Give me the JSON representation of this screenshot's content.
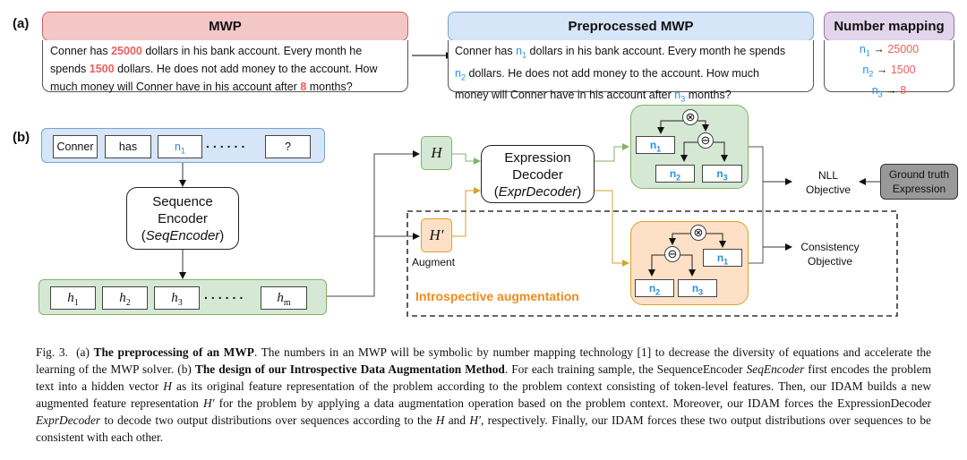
{
  "panel_a": {
    "label": "(a)",
    "mwp": {
      "title": "MWP",
      "text_parts": [
        {
          "t": "Conner has "
        },
        {
          "t": "25000",
          "num": true
        },
        {
          "t": " dollars in his bank account. Every month he spends "
        },
        {
          "t": "1500",
          "num": true
        },
        {
          "t": " dollars. He does not add money to the account. How much money will Conner have in his account after "
        },
        {
          "t": "8",
          "num": true
        },
        {
          "t": " months?"
        }
      ]
    },
    "preprocessed": {
      "title": "Preprocessed MWP",
      "line1_a": "Conner has ",
      "line1_sym": "n",
      "line1_sub": "1",
      "line1_b": " dollars in his bank account. Every month he spends",
      "line2_sym": "n",
      "line2_sub": "2",
      "line2_b": " dollars. He does not add money to the account. How much",
      "line3_a": "money will Conner have in his account after ",
      "line3_sym": "n",
      "line3_sub": "3",
      "line3_b": " months?"
    },
    "mapping": {
      "title": "Number mapping",
      "rows": [
        {
          "sym": "n",
          "sub": "1",
          "arrow": "→",
          "value": "25000"
        },
        {
          "sym": "n",
          "sub": "2",
          "arrow": "→",
          "value": "1500"
        },
        {
          "sym": "n",
          "sub": "3",
          "arrow": "→",
          "value": "8"
        }
      ]
    }
  },
  "panel_b": {
    "label": "(b)",
    "input_tokens": [
      "Conner",
      "has",
      "n1",
      "?"
    ],
    "n1_sym": "n",
    "n1_sub": "1",
    "dots": "......",
    "encoder": {
      "line1": "Sequence",
      "line2": "Encoder",
      "line3_open": "(",
      "line3_name": "SeqEncoder",
      "line3_close": ")"
    },
    "hidden_tokens": [
      {
        "h": "h",
        "sub": "1"
      },
      {
        "h": "h",
        "sub": "2"
      },
      {
        "h": "h",
        "sub": "3"
      },
      {
        "h": "h",
        "sub": "m"
      }
    ],
    "H": "H",
    "H_prime": "H′",
    "augment_label": "Augment",
    "decoder": {
      "line1": "Expression",
      "line2": "Decoder",
      "line3_open": "(",
      "line3_name": "ExprDecoder",
      "line3_close": ")"
    },
    "tree_ops": {
      "mul": "⊗",
      "sub": "⊖"
    },
    "leaf": {
      "n": "n",
      "s1": "1",
      "s2": "2",
      "s3": "3"
    },
    "nll": {
      "line1": "NLL",
      "line2": "Objective"
    },
    "ground_truth": {
      "line1": "Ground truth",
      "line2": "Expression"
    },
    "consistency": {
      "line1": "Consistency",
      "line2": "Objective"
    },
    "introspective_label": "Introspective augmentation"
  },
  "caption": {
    "fig": "Fig. 3.",
    "a_prefix": "(a) ",
    "a_bold": "The preprocessing of an MWP",
    "a_text": ". The numbers in an MWP will be symbolic by number mapping technology [1] to decrease the diversity of equations and accelerate the learning of the MWP solver. ",
    "b_prefix": "(b) ",
    "b_bold": "The design of our Introspective Data Augmentation Method",
    "b_text1": ". For each training sample, the SequenceEncoder ",
    "b_seq": "SeqEncoder",
    "b_text2": " first encodes the problem text into a hidden vector ",
    "b_H": "H",
    "b_text3": " as its original feature representation of the problem according to the problem context consisting of token-level features. Then, our IDAM builds a new augmented feature representation ",
    "b_Hp": "H′",
    "b_text4": " for the problem by applying a data augmentation operation based on the problem context. Moreover, our IDAM forces the ExpressionDecoder ",
    "b_expr": "ExprDecoder",
    "b_text5": " to decode two output distributions over sequences according to the ",
    "b_H2": "H",
    "b_and": " and ",
    "b_Hp2": "H′",
    "b_text6": ", respectively. Finally, our IDAM forces these two output distributions over sequences to be consistent with each other."
  },
  "colors": {
    "mwp_header": "#f4c7c7",
    "mwp_border": "#c86464",
    "pre_header": "#d6e5f7",
    "pre_border": "#7ba1d0",
    "map_header": "#e2d4ea",
    "map_border": "#9a74ac",
    "green_fill": "#d5e8d4",
    "green_border": "#82b366",
    "orange_fill": "#fde0c6",
    "orange_border": "#d9a22b",
    "number_red": "#ee5e5e",
    "symbol_blue": "#2a8ee6",
    "intro_orange": "#f08c1c",
    "gt_fill": "#999999"
  }
}
